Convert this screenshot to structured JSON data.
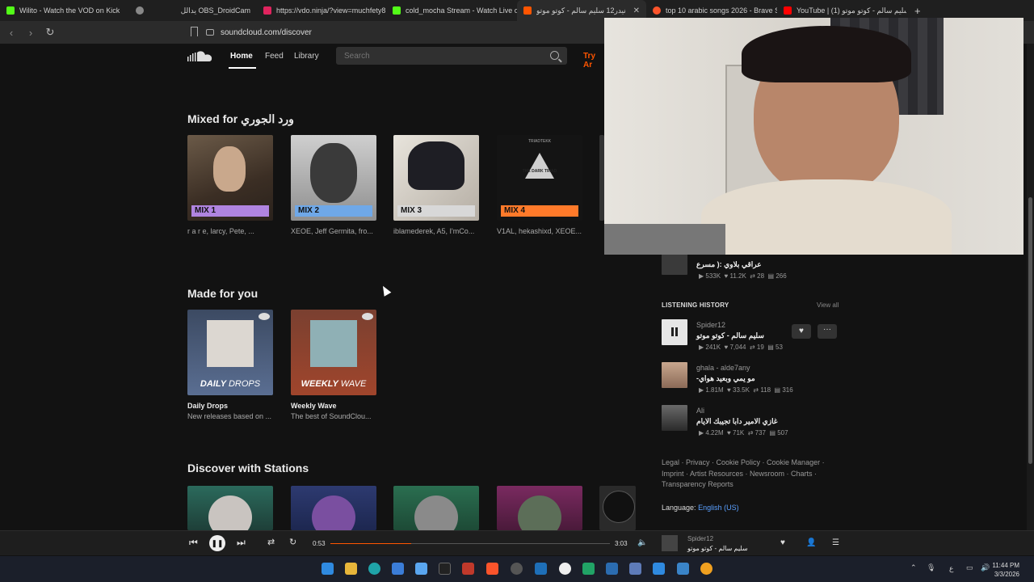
{
  "browser": {
    "tabs": [
      {
        "label": "Wilito - Watch the VOD on Kick",
        "color": "#53fc18",
        "active": false
      },
      {
        "label": "",
        "color": "#888888",
        "active": false
      },
      {
        "label": "يدالل OBS_DroidCam",
        "color": "#333333",
        "active": false
      },
      {
        "label": "https://vdo.ninja/?view=muchfety8K",
        "color": "#e0245e",
        "active": false
      },
      {
        "label": "cold_mocha Stream - Watch Live on",
        "color": "#53fc18",
        "active": false
      },
      {
        "label": "نیدر12 سليم سالم - كوتو موتو",
        "color": "#ff5500",
        "active": true
      },
      {
        "label": "top 10 arabic songs 2026 - Brave Se",
        "color": "#fb542b",
        "active": false
      },
      {
        "label": "YouTube | سليم سالم - كوتو موتو (1)",
        "color": "#ff0000",
        "active": false
      }
    ],
    "new_tab": "+",
    "url": "soundcloud.com/discover"
  },
  "header": {
    "nav": [
      "Home",
      "Feed",
      "Library"
    ],
    "search_placeholder": "Search",
    "try_artist": "Try Ar"
  },
  "sections": {
    "mixed": {
      "title": "Mixed for ورد الجوري",
      "cards": [
        {
          "badge": "MIX 1",
          "badge_color": "#b084e0",
          "sub": "r a r e, larcy, Pete, ..."
        },
        {
          "badge": "MIX 2",
          "badge_color": "#6fa8e8",
          "sub": "XEOE, Jeff Germita, fro..."
        },
        {
          "badge": "MIX 3",
          "badge_color": "#d8d8d8",
          "sub": "iblamederek, A5, I'mCo..."
        },
        {
          "badge": "MIX 4",
          "badge_color": "#ff7a2a",
          "sub": "V1AL, hekashixd, XEOE..."
        }
      ],
      "mix4_art_text": "THE DARK TRIAD",
      "mix4_top_text": "TRIADTEKK"
    },
    "made_for_you": {
      "title": "Made for you",
      "cards": [
        {
          "art_label_a": "DAILY",
          "art_label_b": "DROPS",
          "title": "Daily Drops",
          "sub": "New releases based on ..."
        },
        {
          "art_label_a": "WEEKLY",
          "art_label_b": "WAVE",
          "title": "Weekly Wave",
          "sub": "The best of SoundClou..."
        }
      ]
    },
    "stations": {
      "title": "Discover with Stations"
    }
  },
  "sidebar": {
    "top_track": {
      "title": "عراقي بلاوي :( مسرع",
      "plays": "533K",
      "likes": "11.2K",
      "reposts": "28",
      "comments": "266"
    },
    "history_label": "LISTENING HISTORY",
    "view_all": "View all",
    "history": [
      {
        "user": "Spider12",
        "title": "سليم سالم - كوتو موتو",
        "plays": "241K",
        "likes": "7,044",
        "reposts": "19",
        "comments": "53"
      },
      {
        "user": "ghala - alde7any",
        "title": "-مو يمي وبعيد هواي",
        "plays": "1.81M",
        "likes": "33.5K",
        "reposts": "118",
        "comments": "316"
      },
      {
        "user": "Ali",
        "title": "غازي الامير دابا تجيبك الايام",
        "plays": "4.22M",
        "likes": "71K",
        "reposts": "737",
        "comments": "507"
      }
    ],
    "footer": {
      "line1": "Legal · Privacy · Cookie Policy · Cookie Manager ·",
      "line2": "Imprint · Artist Resources · Newsroom · Charts ·",
      "line3": "Transparency Reports",
      "language_label": "Language:",
      "language_value": "English (US)"
    }
  },
  "player": {
    "elapsed": "0:53",
    "duration": "3:03",
    "progress": 0.29,
    "user": "Spider12",
    "title": "سليم سالم - كوتو موتو"
  },
  "taskbar": {
    "time": "11:44 PM",
    "date": "3/3/2026",
    "lang": "ع"
  }
}
